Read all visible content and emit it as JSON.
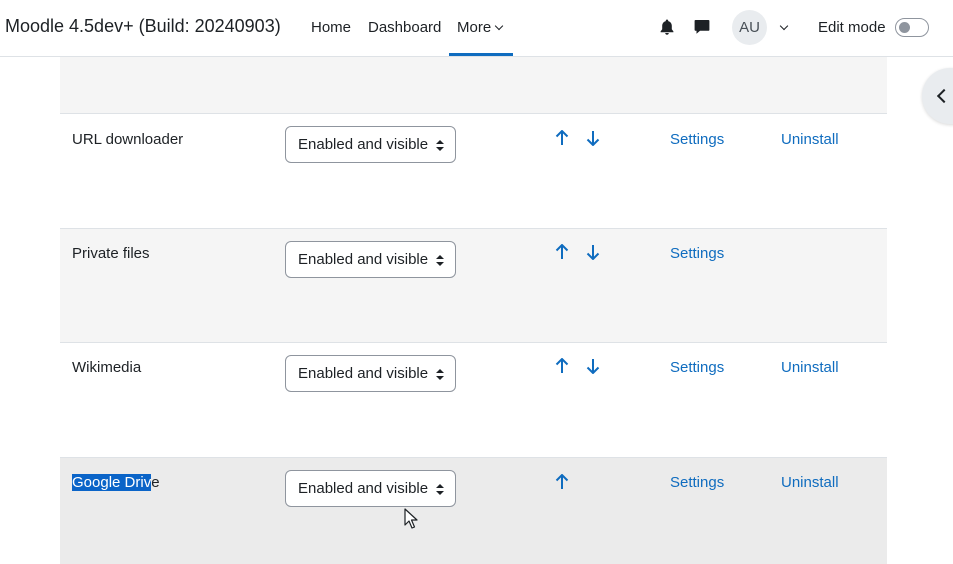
{
  "navbar": {
    "brand": "Moodle 4.5dev+ (Build: 20240903)",
    "links": {
      "home": "Home",
      "dashboard": "Dashboard",
      "more": "More"
    },
    "avatar_initials": "AU",
    "edit_mode_label": "Edit mode",
    "edit_mode_on": false,
    "accent_color": "#0f6cbf"
  },
  "repositories": [
    {
      "name": "URL downloader",
      "status": "Enabled and visible",
      "move_up": true,
      "move_down": true,
      "settings": "Settings",
      "uninstall": "Uninstall"
    },
    {
      "name": "Private files",
      "status": "Enabled and visible",
      "move_up": true,
      "move_down": true,
      "settings": "Settings",
      "uninstall": ""
    },
    {
      "name": "Wikimedia",
      "status": "Enabled and visible",
      "move_up": true,
      "move_down": true,
      "settings": "Settings",
      "uninstall": "Uninstall"
    },
    {
      "name_selected": "Google Driv",
      "name_rest": "e",
      "status": "Enabled and visible",
      "move_up": true,
      "move_down": false,
      "settings": "Settings",
      "uninstall": "Uninstall"
    }
  ],
  "icons": {
    "notification": "bell-icon",
    "messages": "chat-icon",
    "move_up": "arrow-up-icon",
    "move_down": "arrow-down-icon",
    "drawer": "chevron-left-icon"
  }
}
